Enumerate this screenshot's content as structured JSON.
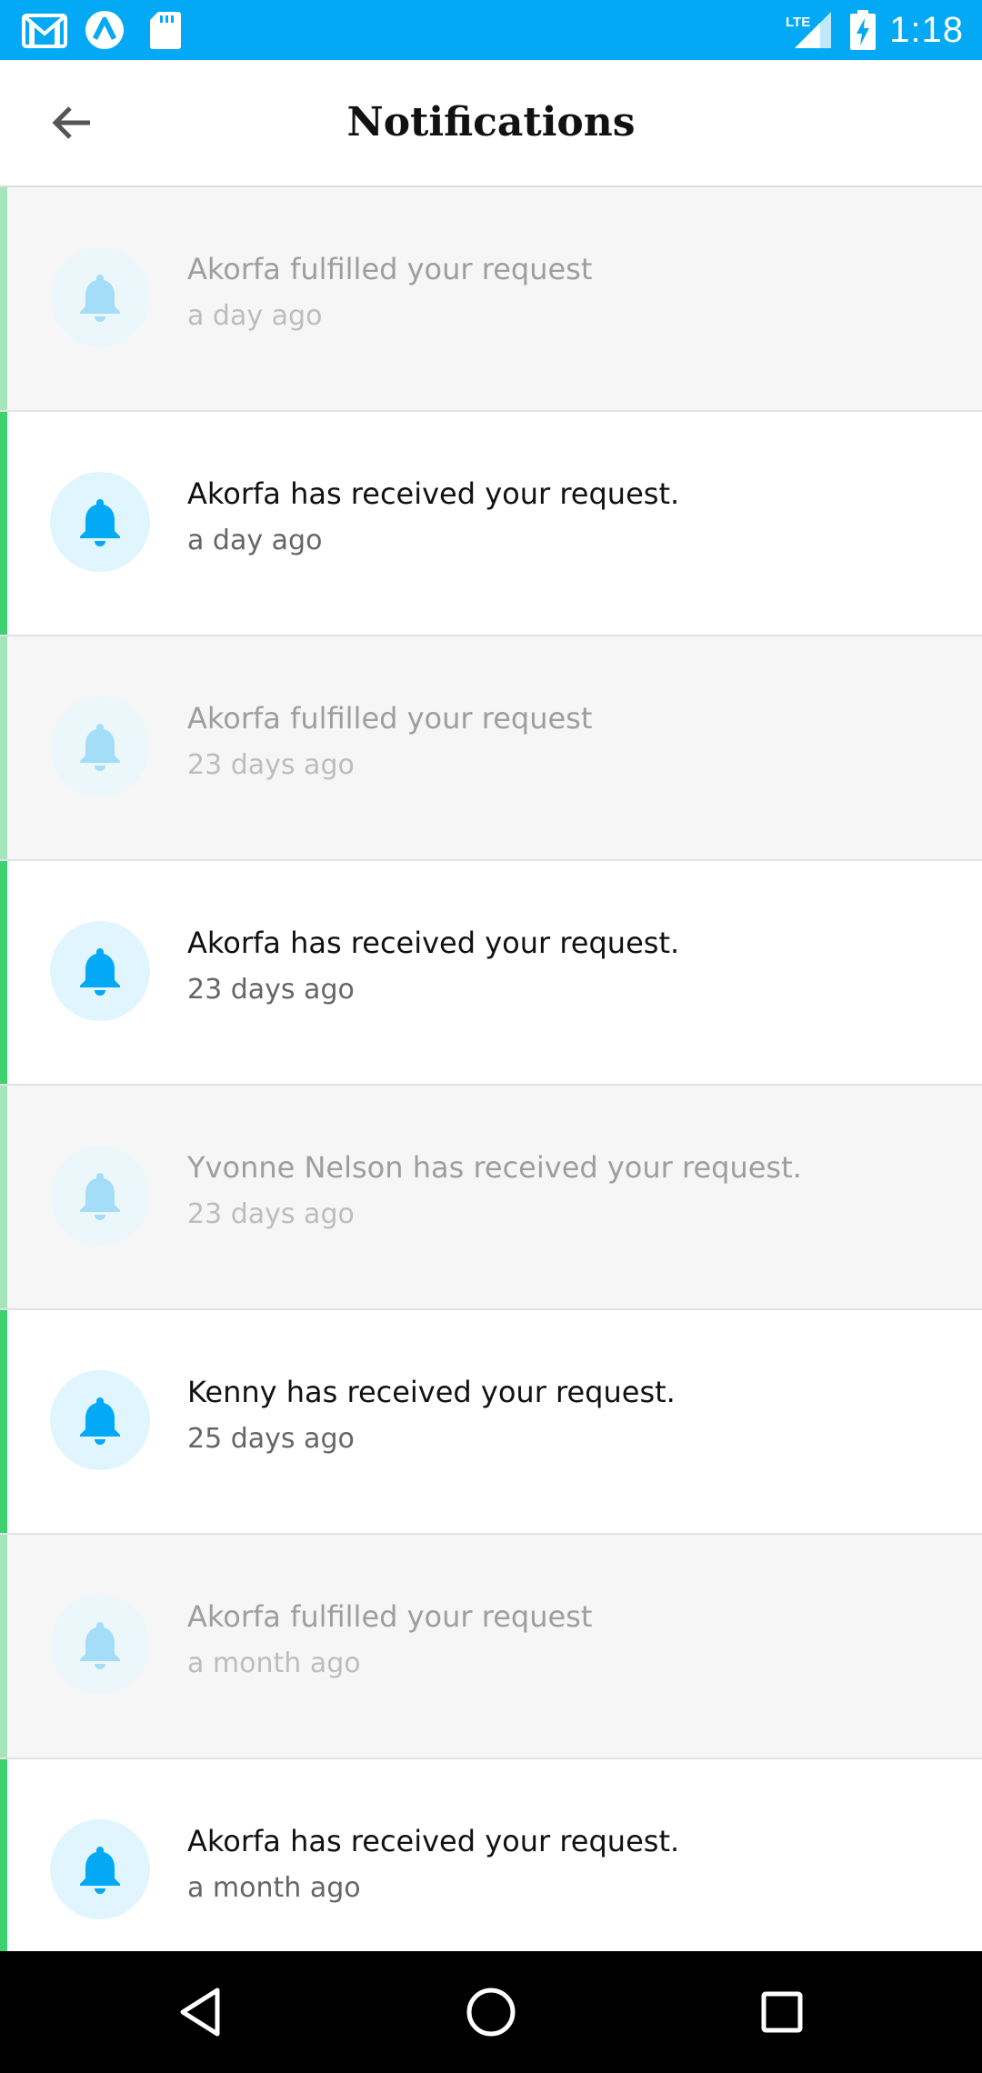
{
  "status_bar": {
    "time": "1:18",
    "icons": [
      "gmail-icon",
      "app-notification-icon",
      "sd-card-icon",
      "lte-signal-icon",
      "battery-charging-icon"
    ],
    "background": "#03A9F4",
    "network_label": "LTE"
  },
  "app_bar": {
    "title": "Notifications",
    "back_icon": "arrow-left-icon"
  },
  "colors": {
    "accent_unread": "#3DD16F",
    "accent_read": "#A6E5BC",
    "bell": "#03A9F4"
  },
  "notifications": [
    {
      "message": "Akorfa fulfilled your request",
      "time": "a day ago",
      "read": true
    },
    {
      "message": "Akorfa has received your request.",
      "time": "a day ago",
      "read": false
    },
    {
      "message": "Akorfa fulfilled your request",
      "time": "23 days ago",
      "read": true
    },
    {
      "message": "Akorfa has received your request.",
      "time": "23 days ago",
      "read": false
    },
    {
      "message": "Yvonne Nelson has received your request.",
      "time": "23 days ago",
      "read": true
    },
    {
      "message": "Kenny has received your request.",
      "time": "25 days ago",
      "read": false
    },
    {
      "message": "Akorfa fulfilled your request",
      "time": "a month ago",
      "read": true
    },
    {
      "message": "Akorfa has received your request.",
      "time": "a month ago",
      "read": false
    }
  ],
  "nav_bar": {
    "buttons": [
      "back-triangle-icon",
      "home-circle-icon",
      "recents-square-icon"
    ]
  }
}
